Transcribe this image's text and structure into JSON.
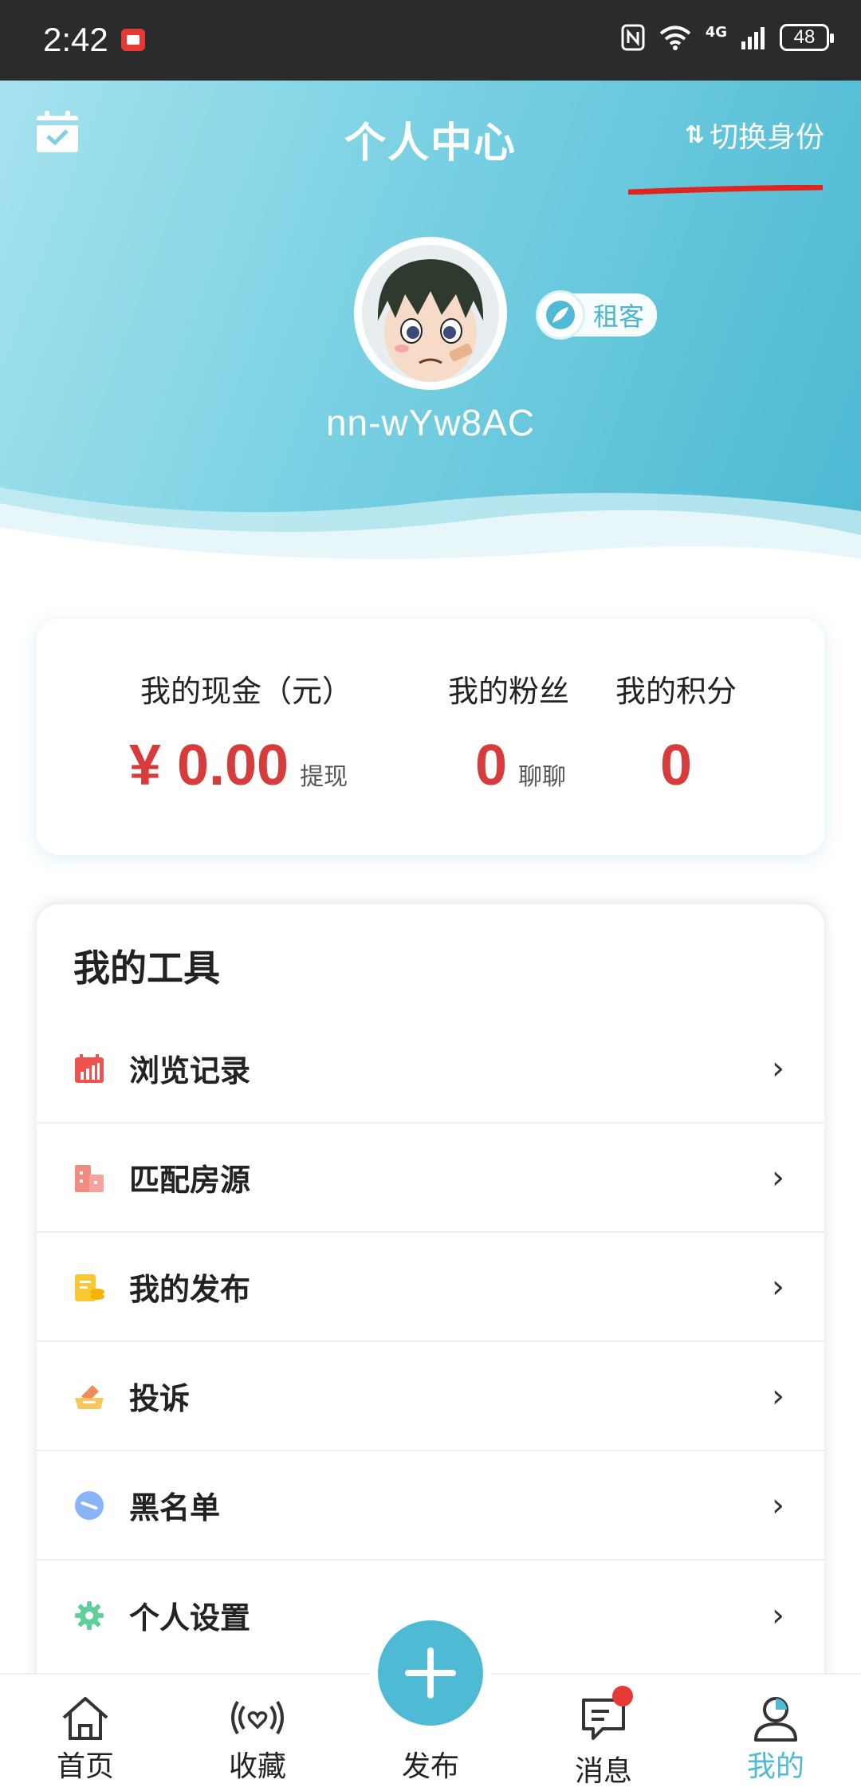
{
  "status_bar": {
    "time": "2:42",
    "network": "4G",
    "battery": "48"
  },
  "header": {
    "title": "个人中心",
    "switch_role": "切换身份"
  },
  "profile": {
    "role": "租客",
    "username": "nn-wYw8AC"
  },
  "stats": {
    "cash_title": "我的现金（元）",
    "cash_value": "¥ 0.00",
    "cash_action": "提现",
    "fans_title": "我的粉丝",
    "fans_value": "0",
    "fans_action": "聊聊",
    "points_title": "我的积分",
    "points_value": "0"
  },
  "tools": {
    "title": "我的工具",
    "items": [
      {
        "label": "浏览记录",
        "icon": "history-chart-icon",
        "color": "#ef5350"
      },
      {
        "label": "匹配房源",
        "icon": "building-icon",
        "color": "#f28b82"
      },
      {
        "label": "我的发布",
        "icon": "document-coins-icon",
        "color": "#f9c933"
      },
      {
        "label": "投诉",
        "icon": "complaint-tray-icon",
        "color": "#f5a623"
      },
      {
        "label": "黑名单",
        "icon": "block-icon",
        "color": "#8ab4f8"
      },
      {
        "label": "个人设置",
        "icon": "gear-icon",
        "color": "#5fcf9b"
      }
    ]
  },
  "bottom_nav": {
    "home": "首页",
    "favorites": "收藏",
    "publish": "发布",
    "messages": "消息",
    "mine": "我的"
  },
  "colors": {
    "accent": "#4fbad3",
    "price_red": "#d63c3c",
    "annotation_red": "#e0241f"
  }
}
